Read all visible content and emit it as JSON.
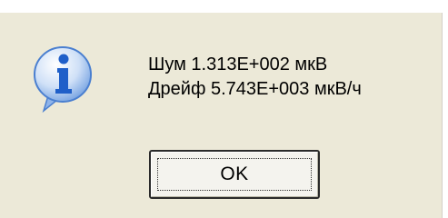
{
  "dialog": {
    "message_line1": "Шум 1.313E+002 мкВ",
    "message_line2": "Дрейф 5.743E+003 мкВ/ч",
    "ok_label": "OK",
    "icon": "info-icon",
    "colors": {
      "background": "#ece9d8",
      "icon_blue": "#2f6fd6"
    }
  }
}
